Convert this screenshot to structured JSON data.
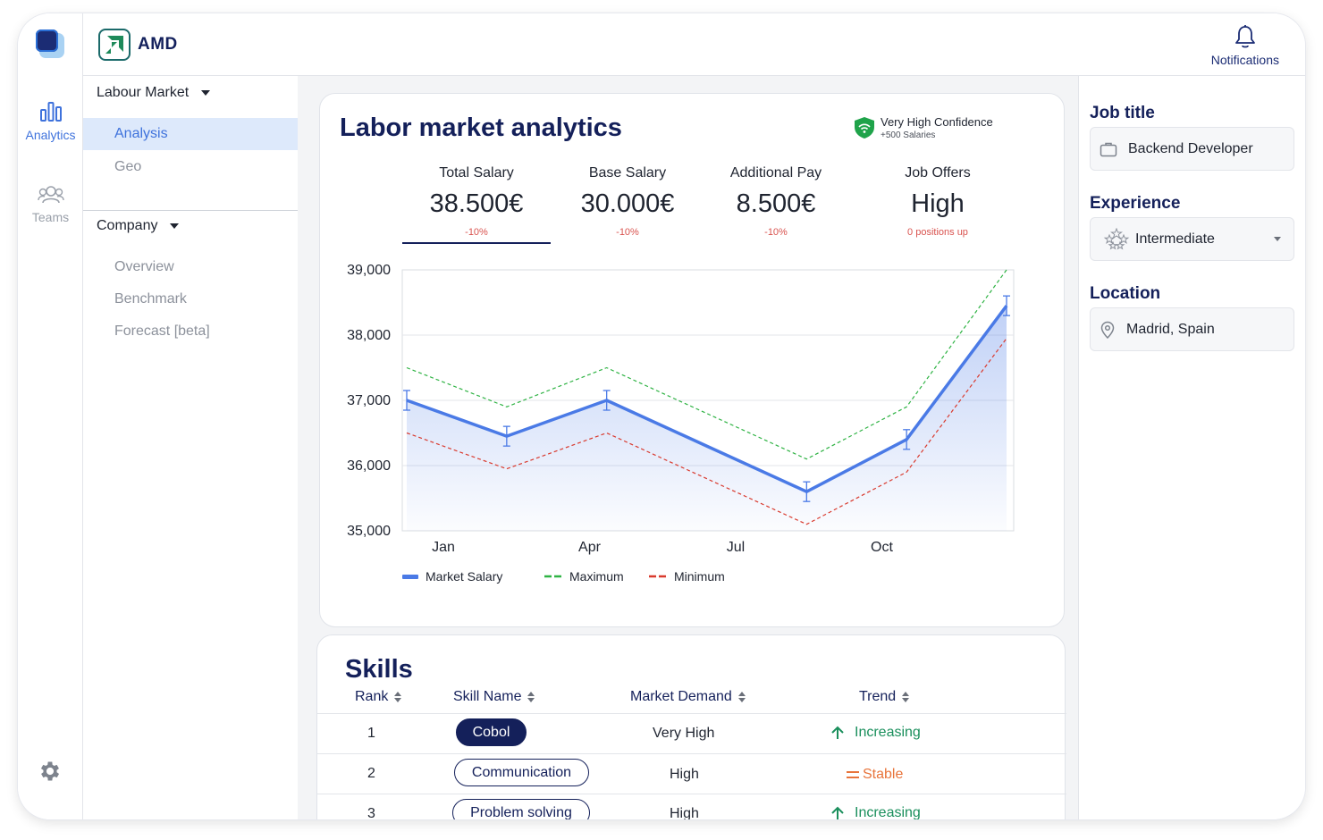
{
  "app": {
    "name": "AMD"
  },
  "rail": {
    "analytics_label": "Analytics",
    "teams_label": "Teams",
    "icons": [
      "bar-chart-icon",
      "users-icon",
      "gear-icon"
    ]
  },
  "header": {
    "notifications_label": "Notifications"
  },
  "subnav": {
    "group1": {
      "label": "Labour Market",
      "items": [
        "Analysis",
        "Geo"
      ],
      "active": "Analysis"
    },
    "group2": {
      "label": "Company",
      "items": [
        "Overview",
        "Benchmark",
        "Forecast [beta]"
      ]
    }
  },
  "analytics": {
    "title": "Labor market analytics",
    "confidence": {
      "label": "Very High Confidence",
      "sub": "+500 Salaries"
    },
    "kpis": [
      {
        "label": "Total Salary",
        "value": "38.500€",
        "change": "-10%"
      },
      {
        "label": "Base Salary",
        "value": "30.000€",
        "change": "-10%"
      },
      {
        "label": "Additional Pay",
        "value": "8.500€",
        "change": "-10%"
      },
      {
        "label": "Job Offers",
        "value": "High",
        "change": "0 positions up"
      }
    ]
  },
  "chart_data": {
    "type": "line",
    "x_tick_labels": [
      "Jan",
      "Apr",
      "Jul",
      "Oct"
    ],
    "y_tick_labels": [
      "39,000",
      "38,000",
      "37,000",
      "36,000",
      "35,000"
    ],
    "ylim": [
      35000,
      39000
    ],
    "series": [
      {
        "name": "Market Salary",
        "color": "#4a7ae6",
        "style": "solid",
        "values": [
          37000,
          36450,
          37000,
          36300,
          35600,
          36400,
          38450
        ]
      },
      {
        "name": "Maximum",
        "color": "#2fb344",
        "style": "dashed",
        "values": [
          37500,
          36900,
          37500,
          36800,
          36100,
          36900,
          39000
        ]
      },
      {
        "name": "Minimum",
        "color": "#d93a2e",
        "style": "dashed",
        "values": [
          36500,
          35950,
          36500,
          35800,
          35100,
          35900,
          37950
        ]
      }
    ],
    "grid": true,
    "legend_position": "bottom-left"
  },
  "skills": {
    "title": "Skills",
    "headers": [
      "Rank",
      "Skill Name",
      "Market Demand",
      "Trend"
    ],
    "rows": [
      {
        "rank": "1",
        "skill": "Cobol",
        "demand": "Very High",
        "trend": "Increasing"
      },
      {
        "rank": "2",
        "skill": "Communication",
        "demand": "High",
        "trend": "Stable"
      },
      {
        "rank": "3",
        "skill": "Problem solving",
        "demand": "High",
        "trend": "Increasing"
      }
    ]
  },
  "filters": {
    "job_title": {
      "label": "Job title",
      "value": "Backend Developer"
    },
    "experience": {
      "label": "Experience",
      "value": "Intermediate"
    },
    "location": {
      "label": "Location",
      "value": "Madrid, Spain"
    }
  },
  "colors": {
    "navy": "#14205a",
    "accent": "#3e72dc",
    "increase": "#1a8f5c",
    "stable": "#e8743b",
    "negative": "#d9534f"
  }
}
